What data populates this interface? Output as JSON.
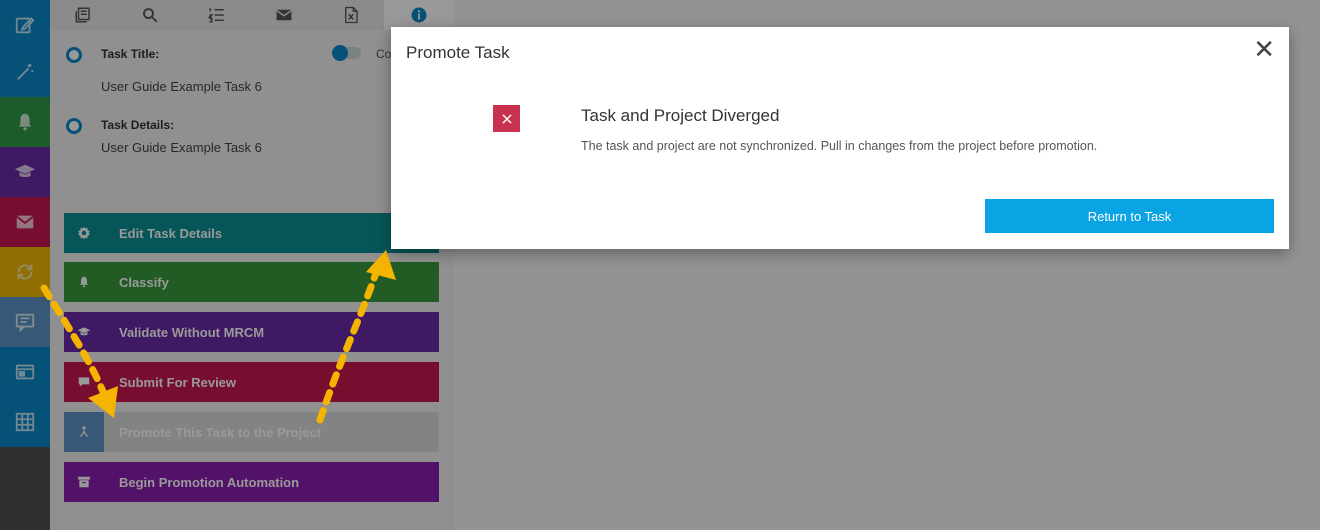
{
  "rail": {
    "items": [
      {
        "icon": "edit-icon",
        "color": "#0a87c8"
      },
      {
        "icon": "magic-wand-icon",
        "color": "#0a87c8"
      },
      {
        "icon": "bell-icon",
        "color": "#2e9a47"
      },
      {
        "icon": "graduation-cap-icon",
        "color": "#6a2aa5"
      },
      {
        "icon": "envelope-icon",
        "color": "#c8184f"
      },
      {
        "icon": "sync-icon",
        "color": "#f2b705"
      },
      {
        "icon": "message-icon",
        "color": "#5d95c6"
      },
      {
        "icon": "browser-window-icon",
        "color": "#0a87c8"
      },
      {
        "icon": "grid-icon",
        "color": "#0a87c8"
      }
    ]
  },
  "panel": {
    "tabs": [
      {
        "icon": "library-icon"
      },
      {
        "icon": "search-icon"
      },
      {
        "icon": "numbered-list-icon"
      },
      {
        "icon": "mail-icon"
      },
      {
        "icon": "excel-file-icon"
      },
      {
        "icon": "info-icon",
        "active": true
      }
    ],
    "toggle_label": "Co",
    "fields": {
      "task_title_label": "Task Title:",
      "task_title_value": "User Guide Example Task 6",
      "task_details_label": "Task Details:",
      "task_details_value": "User Guide Example Task 6"
    },
    "actions": [
      {
        "label": "Edit Task Details",
        "icon": "gear-icon",
        "color": "#0a8f95"
      },
      {
        "label": "Classify",
        "icon": "bell-icon",
        "color": "#3a9a3c"
      },
      {
        "label": "Validate Without MRCM",
        "icon": "graduation-cap-icon",
        "color": "#6a2aa5"
      },
      {
        "label": "Submit For Review",
        "icon": "chat-icon",
        "color": "#c8184f"
      },
      {
        "label": "Promote This Task to the Project",
        "icon": "merge-icon",
        "color": "#dadada",
        "icon_bg": "#5d95c6"
      },
      {
        "label": "Begin Promotion Automation",
        "icon": "archive-icon",
        "color": "#8a1eb0"
      }
    ]
  },
  "modal": {
    "title": "Promote Task",
    "close_symbol": "✕",
    "error_title": "Task and Project Diverged",
    "error_message": "The task and project are not synchronized. Pull in changes from the project before promotion.",
    "button_label": "Return to Task",
    "accent_color": "#0aa3e3",
    "error_color": "#c8324f"
  },
  "annotation": {
    "arrow_color": "#f5b400"
  }
}
